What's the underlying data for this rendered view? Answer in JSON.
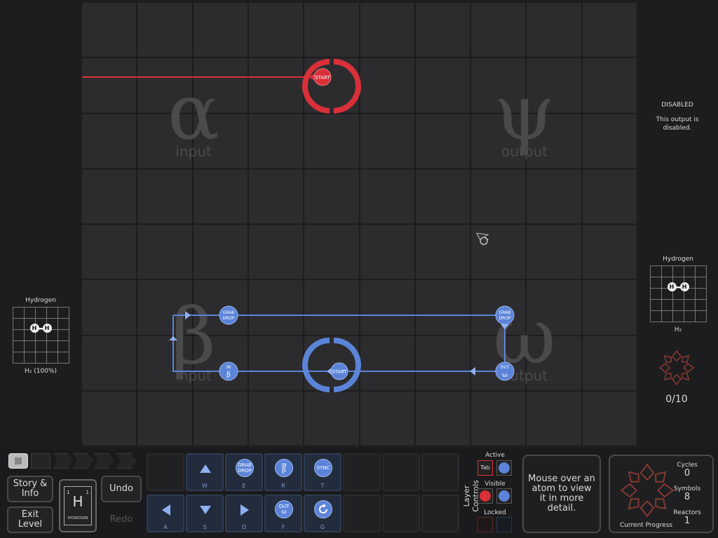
{
  "board": {
    "regions": {
      "alpha": {
        "symbol": "α",
        "caption": "input"
      },
      "psi": {
        "symbol": "ψ",
        "caption": "output"
      },
      "beta": {
        "symbol": "β",
        "caption": "input"
      },
      "omega": {
        "symbol": "ω",
        "caption": "output"
      }
    },
    "red_start_label": "START",
    "blue_start_label": "START",
    "blue_nodes": [
      {
        "line1": "GRAB",
        "line2": "DROP"
      },
      {
        "line1": "GRAB",
        "line2": "DROP"
      },
      {
        "line1": "IN",
        "line2": "β"
      },
      {
        "line1": "OUT",
        "line2": "ω"
      }
    ]
  },
  "right_panel": {
    "status_title": "DISABLED",
    "status_text": "This output is disabled.",
    "molecule_title": "Hydrogen",
    "formula": "H₂",
    "progress": "0/10"
  },
  "left_panel": {
    "molecule_title": "Hydrogen",
    "formula": "H₂ (100%)"
  },
  "atom_symbol": "H",
  "element": {
    "number": "1",
    "symbol": "H",
    "name": "HYDROGEN"
  },
  "buttons": {
    "story": "Story & Info",
    "exit": "Exit Level",
    "undo": "Undo",
    "redo": "Redo"
  },
  "palette": {
    "top": [
      {
        "kind": "arrow",
        "dir": "up",
        "key": "W"
      },
      {
        "kind": "circle",
        "l1": "GRAB",
        "l2": "DROP",
        "key": "E"
      },
      {
        "kind": "circle",
        "l1": "IN",
        "l2": "β",
        "key": "R"
      },
      {
        "kind": "circle",
        "l1": "SYNC",
        "l2": "",
        "key": "T"
      }
    ],
    "bottom": [
      {
        "kind": "arrow",
        "dir": "left",
        "key": "A"
      },
      {
        "kind": "arrow",
        "dir": "down",
        "key": "S"
      },
      {
        "kind": "arrow",
        "dir": "right",
        "key": "D"
      },
      {
        "kind": "circle",
        "l1": "OUT",
        "l2": "ω",
        "key": "F"
      },
      {
        "kind": "rotate",
        "l1": "",
        "l2": "",
        "key": "G"
      }
    ]
  },
  "layer_controls": {
    "title": "Layer Controls",
    "active": "Active",
    "tab_key": "Tab",
    "visible": "Visible",
    "locked": "Locked"
  },
  "tooltip": "Mouse over an atom to view it in more detail.",
  "stats": {
    "cycles_label": "Cycles",
    "cycles": "0",
    "symbols_label": "Symbols",
    "symbols": "8",
    "reactors_label": "Reactors",
    "reactors": "1",
    "progress_label": "Current Progress"
  },
  "colors": {
    "red": "#d9303a",
    "blue": "#5b84d9",
    "blue_light": "#8fb0f0",
    "panel": "#2c2c2e"
  }
}
